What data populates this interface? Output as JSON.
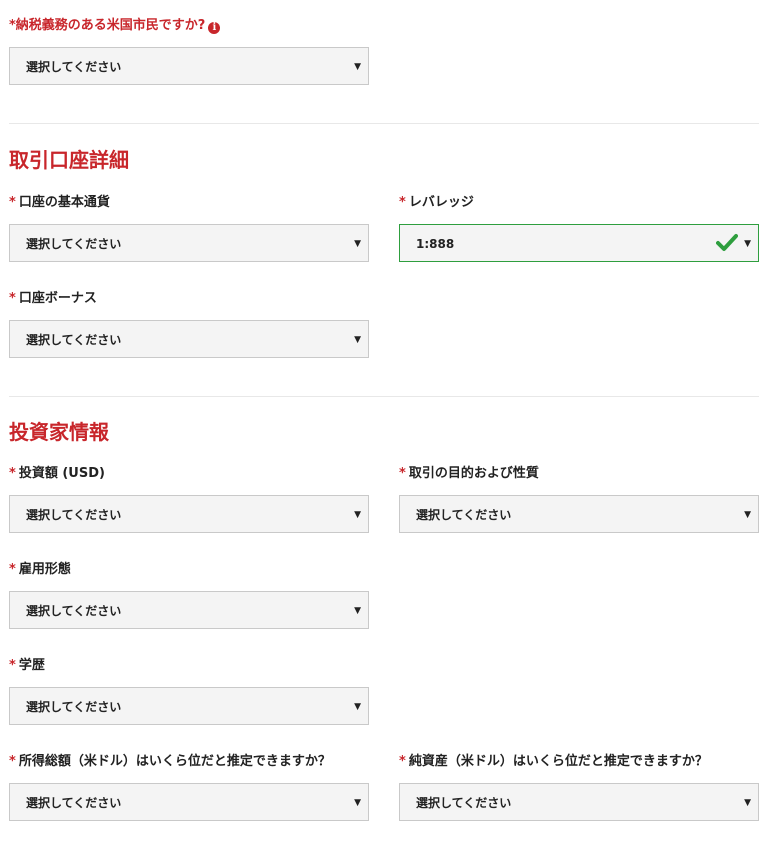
{
  "us_tax": {
    "label": "*納税義務のある米国市民ですか?",
    "value": "選択してください"
  },
  "account_details": {
    "title": "取引口座詳細",
    "base_currency": {
      "label": "口座の基本通貨",
      "value": "選択してください"
    },
    "leverage": {
      "label": "レバレッジ",
      "value": "1:888"
    },
    "bonus": {
      "label": "口座ボーナス",
      "value": "選択してください"
    }
  },
  "investor_info": {
    "title": "投資家情報",
    "investment_amount": {
      "label": "投資額 (USD)",
      "value": "選択してください"
    },
    "trade_purpose": {
      "label": "取引の目的および性質",
      "value": "選択してください"
    },
    "employment": {
      "label": "雇用形態",
      "value": "選択してください"
    },
    "education": {
      "label": "学歴",
      "value": "選択してください"
    },
    "income": {
      "label": "所得総額（米ドル）はいくら位だと推定できますか？",
      "value": "選択してください"
    },
    "net_worth": {
      "label": "純資産（米ドル）はいくら位だと推定できますか？",
      "value": "選択してください"
    }
  },
  "common": {
    "asterisk": "*",
    "arrow": "▼",
    "info_glyph": "i"
  },
  "colors": {
    "accent_red": "#c8262b",
    "valid_green": "#2e9e3e",
    "select_bg": "#f4f4f4"
  }
}
